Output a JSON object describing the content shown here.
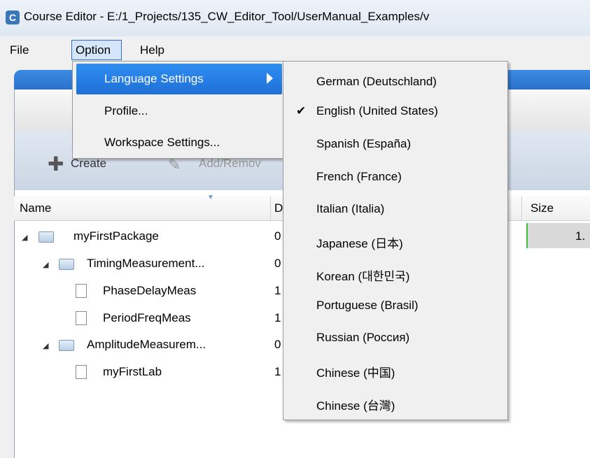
{
  "window": {
    "title": "Course Editor - E:/1_Projects/135_CW_Editor_Tool/UserManual_Examples/v",
    "icon": "app-logo-icon"
  },
  "menubar": {
    "file": "File",
    "option": "Option",
    "help": "Help"
  },
  "toolbar": {
    "create": "Create",
    "add_remove": "Add/Remov"
  },
  "table": {
    "headers": {
      "name": "Name",
      "d": "D",
      "size": "Size"
    },
    "rows": [
      {
        "name": "myFirstPackage",
        "d": "0"
      },
      {
        "name": "TimingMeasurement...",
        "d": "0"
      },
      {
        "name": "PhaseDelayMeas",
        "d": "1"
      },
      {
        "name": "PeriodFreqMeas",
        "d": "1"
      },
      {
        "name": "AmplitudeMeasurem...",
        "d": "0"
      },
      {
        "name": "myFirstLab",
        "d": "1"
      }
    ],
    "size_first": "1."
  },
  "option_menu": {
    "items": [
      "Language Settings",
      "Profile...",
      "Workspace Settings..."
    ]
  },
  "language_menu": {
    "items": [
      "German (Deutschland)",
      "English (United States)",
      "Spanish (España)",
      "French (France)",
      "Italian (Italia)",
      "Japanese (日本)",
      "Korean (대한민국)",
      "Portuguese (Brasil)",
      "Russian (Россия)",
      "Chinese (中国)",
      "Chinese (台灣)"
    ],
    "checked_index": 1
  },
  "colors": {
    "accent": "#1e6fd6",
    "size_bar": "#3cc43c"
  }
}
